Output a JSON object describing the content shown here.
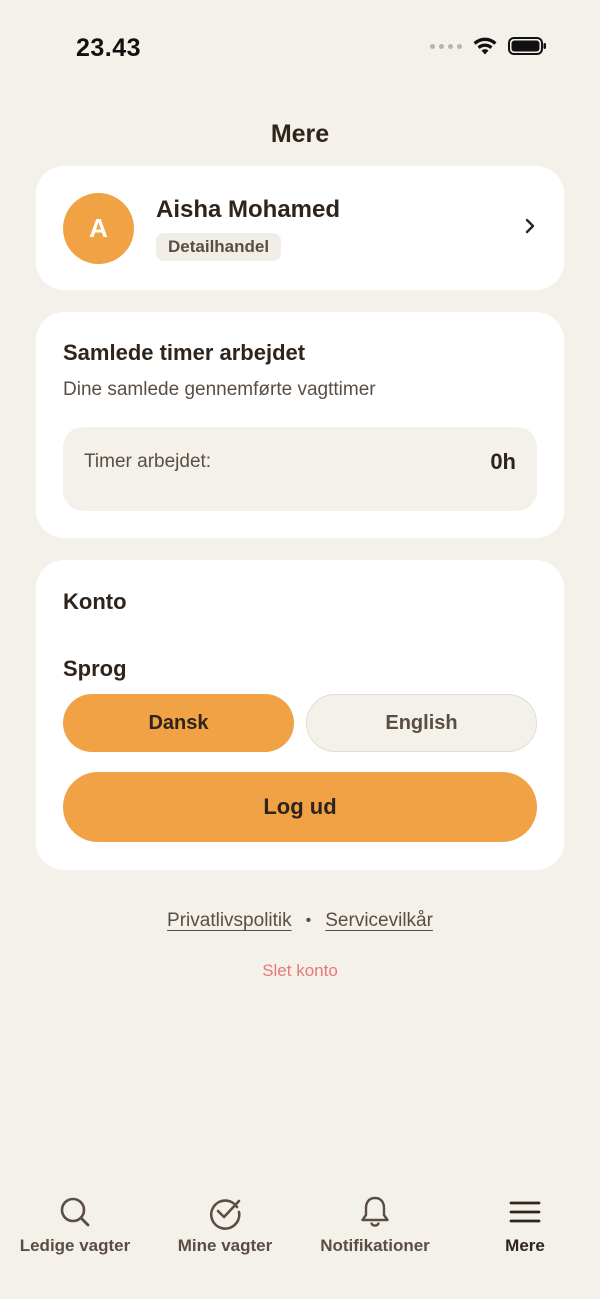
{
  "status_bar": {
    "time": "23.43"
  },
  "header": {
    "title": "Mere"
  },
  "profile": {
    "initial": "A",
    "name": "Aisha Mohamed",
    "tag": "Detailhandel"
  },
  "hours": {
    "title": "Samlede timer arbejdet",
    "subtitle": "Dine samlede gennemførte vagttimer",
    "label": "Timer arbejdet:",
    "value": "0h"
  },
  "account": {
    "title": "Konto",
    "language_title": "Sprog",
    "languages": [
      {
        "label": "Dansk",
        "selected": true
      },
      {
        "label": "English",
        "selected": false
      }
    ],
    "logout_label": "Log ud"
  },
  "footer": {
    "privacy": "Privatlivspolitik",
    "separator": "•",
    "terms": "Servicevilkår",
    "delete_account": "Slet konto"
  },
  "tabbar": {
    "items": [
      {
        "label": "Ledige vagter",
        "icon": "search-icon",
        "active": false
      },
      {
        "label": "Mine vagter",
        "icon": "check-circle-icon",
        "active": false
      },
      {
        "label": "Notifikationer",
        "icon": "bell-icon",
        "active": false
      },
      {
        "label": "Mere",
        "icon": "menu-icon",
        "active": true
      }
    ]
  },
  "colors": {
    "background": "#f4f1ea",
    "accent": "#f0a244",
    "text": "#2e241c",
    "danger": "#e8787a"
  }
}
